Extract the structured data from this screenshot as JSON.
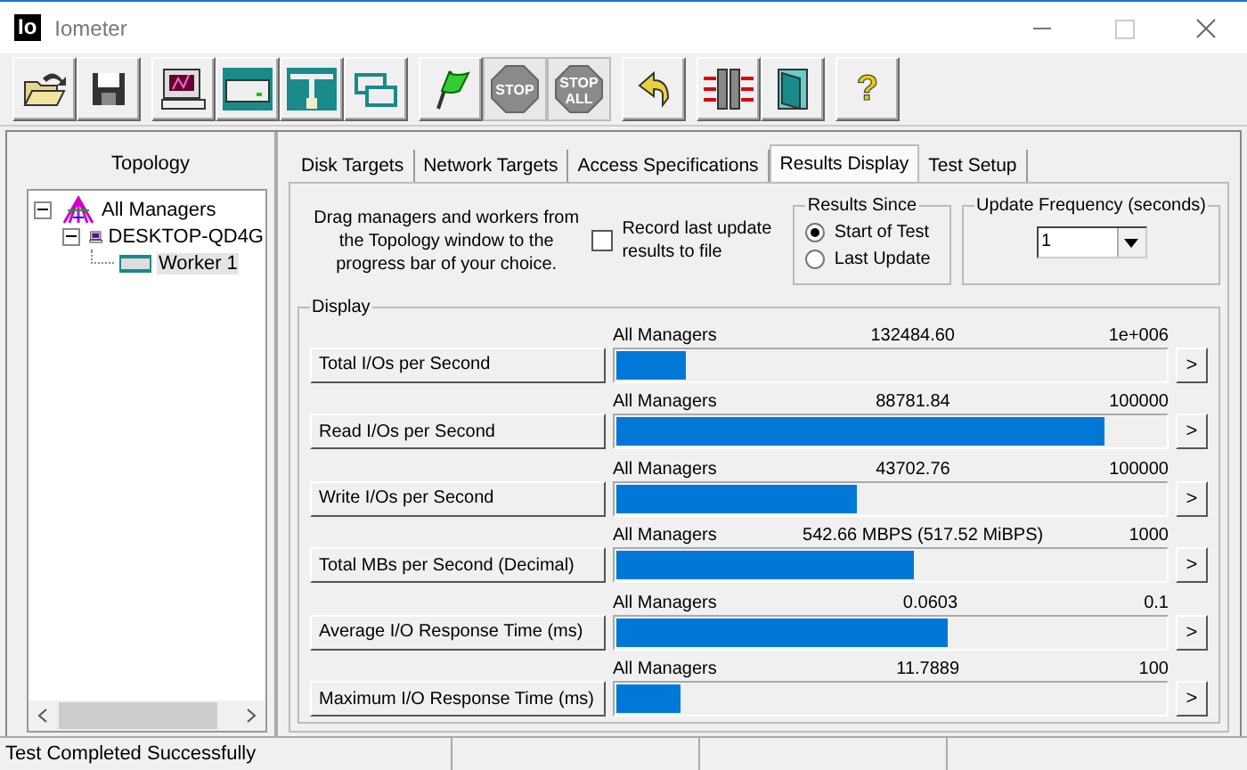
{
  "window": {
    "logo": "Io",
    "title": "Iometer"
  },
  "toolbar": [
    [
      {
        "kind": "open",
        "disabled": false
      },
      {
        "kind": "save",
        "disabled": false
      }
    ],
    [
      {
        "kind": "display",
        "disabled": false
      },
      {
        "kind": "disk",
        "disabled": false
      },
      {
        "kind": "network",
        "disabled": false
      },
      {
        "kind": "copy",
        "disabled": false
      }
    ],
    [
      {
        "kind": "start",
        "disabled": false
      },
      {
        "kind": "stop",
        "disabled": true,
        "label": "STOP"
      },
      {
        "kind": "stop",
        "disabled": true,
        "label": "STOP",
        "label2": "ALL"
      }
    ],
    [
      {
        "kind": "reset",
        "disabled": false
      }
    ],
    [
      {
        "kind": "split",
        "disabled": false
      },
      {
        "kind": "exit",
        "disabled": false
      }
    ],
    [
      {
        "kind": "help",
        "disabled": false,
        "label": "?"
      }
    ]
  ],
  "topology": {
    "title": "Topology",
    "tree": [
      {
        "label": "All Managers",
        "kind": "managers",
        "expanded": true,
        "selected": false,
        "children": [
          {
            "label": "DESKTOP-QD4G",
            "kind": "computer",
            "expanded": true,
            "selected": false,
            "children": [
              {
                "label": "Worker 1",
                "kind": "worker",
                "selected": true
              }
            ]
          }
        ]
      }
    ]
  },
  "tabs": [
    {
      "label": "Disk Targets",
      "selected": false
    },
    {
      "label": "Network Targets",
      "selected": false
    },
    {
      "label": "Access Specifications",
      "selected": false
    },
    {
      "label": "Results Display",
      "selected": true
    },
    {
      "label": "Test Setup",
      "selected": false
    }
  ],
  "results": {
    "hint": "Drag managers and workers from the Topology window to the progress bar of your choice.",
    "record": {
      "label": "Record last update results to file",
      "checked": false
    },
    "results_since": {
      "title": "Results Since",
      "options": [
        {
          "label": "Start of Test",
          "selected": true
        },
        {
          "label": "Last Update",
          "selected": false
        }
      ]
    },
    "update_frequency": {
      "title": "Update Frequency (seconds)",
      "value": "1"
    },
    "display": {
      "title": "Display",
      "rows": [
        {
          "button": "Total I/Os per Second",
          "source": "All Managers",
          "value": "132484.60",
          "max": "1e+006",
          "level": 0.125
        },
        {
          "button": "Read I/Os per Second",
          "source": "All Managers",
          "value": "88781.84",
          "max": "100000",
          "level": 0.888
        },
        {
          "button": "Write I/Os per Second",
          "source": "All Managers",
          "value": "43702.76",
          "max": "100000",
          "level": 0.437
        },
        {
          "button": "Total MBs per Second (Decimal)",
          "source": "All Managers",
          "value": "542.66 MBPS (517.52 MiBPS)",
          "max": "1000",
          "level": 0.543
        },
        {
          "button": "Average I/O Response Time (ms)",
          "source": "All Managers",
          "value": "0.0603",
          "max": "0.1",
          "level": 0.603
        },
        {
          "button": "Maximum I/O Response Time (ms)",
          "source": "All Managers",
          "value": "11.7889",
          "max": "100",
          "level": 0.118
        }
      ],
      "more": ">"
    }
  },
  "status_bar": {
    "text": "Test Completed Successfully"
  }
}
